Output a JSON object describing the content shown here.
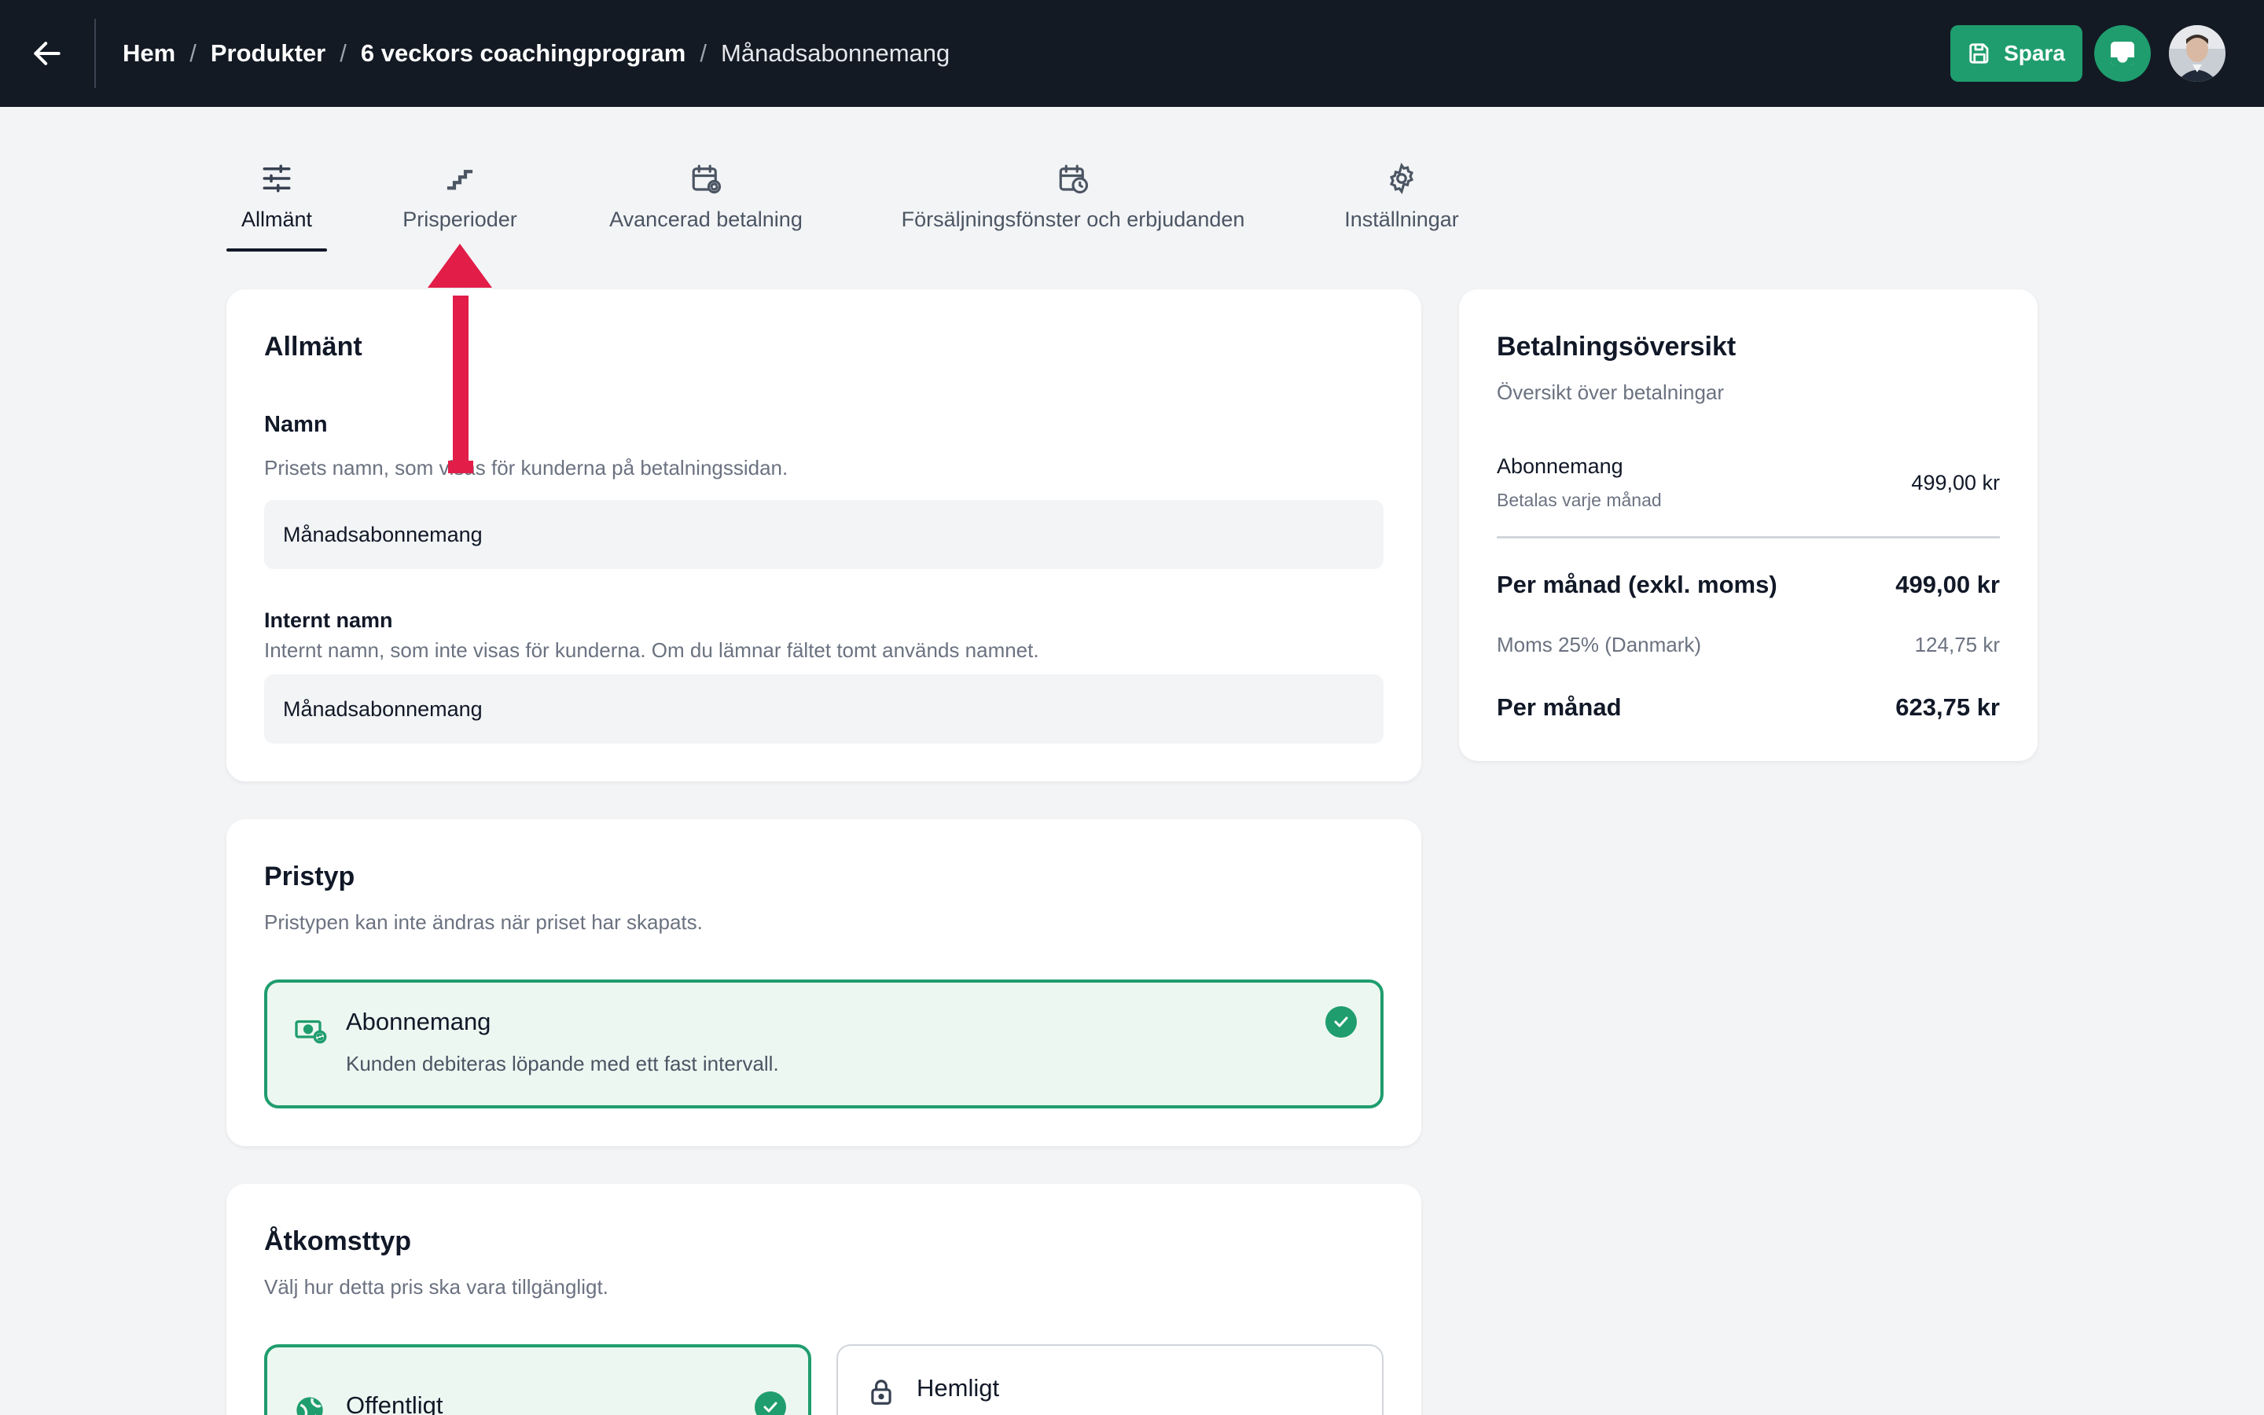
{
  "topbar": {
    "breadcrumb": [
      "Hem",
      "Produkter",
      "6 veckors coachingprogram",
      "Månadsabonnemang"
    ],
    "save_label": "Spara",
    "accent_color": "#1f9d6e"
  },
  "tabs": [
    {
      "label": "Allmänt",
      "icon": "sliders-icon",
      "active": true
    },
    {
      "label": "Prisperioder",
      "icon": "stairs-icon",
      "active": false
    },
    {
      "label": "Avancerad betalning",
      "icon": "calendar-refresh-icon",
      "active": false
    },
    {
      "label": "Försäljningsfönster och erbjudanden",
      "icon": "calendar-clock-icon",
      "active": false
    },
    {
      "label": "Inställningar",
      "icon": "gear-icon",
      "active": false
    }
  ],
  "general": {
    "title": "Allmänt",
    "name_label": "Namn",
    "name_desc": "Prisets namn, som visas för kunderna på betalningssidan.",
    "name_value": "Månadsabonnemang",
    "internal_label": "Internt namn",
    "internal_desc": "Internt namn, som inte visas för kunderna. Om du lämnar fältet tomt används namnet.",
    "internal_value": "Månadsabonnemang"
  },
  "price_type": {
    "title": "Pristyp",
    "desc": "Pristypen kan inte ändras när priset har skapats.",
    "option_title": "Abonnemang",
    "option_desc": "Kunden debiteras löpande med ett fast intervall."
  },
  "access": {
    "title": "Åtkomsttyp",
    "desc": "Välj hur detta pris ska vara tillgängligt.",
    "options": [
      {
        "label": "Offentligt",
        "icon": "globe-icon",
        "selected": true
      },
      {
        "label": "Hemligt",
        "icon": "lock-icon",
        "selected": false
      }
    ]
  },
  "summary": {
    "title": "Betalningsöversikt",
    "subtitle": "Översikt över betalningar",
    "item_name": "Abonnemang",
    "item_sub": "Betalas varje månad",
    "item_price": "499,00 kr",
    "per_month_excl_label": "Per månad (exkl. moms)",
    "per_month_excl_value": "499,00 kr",
    "vat_label": "Moms 25% (Danmark)",
    "vat_value": "124,75 kr",
    "per_month_label": "Per månad",
    "per_month_value": "623,75 kr"
  }
}
